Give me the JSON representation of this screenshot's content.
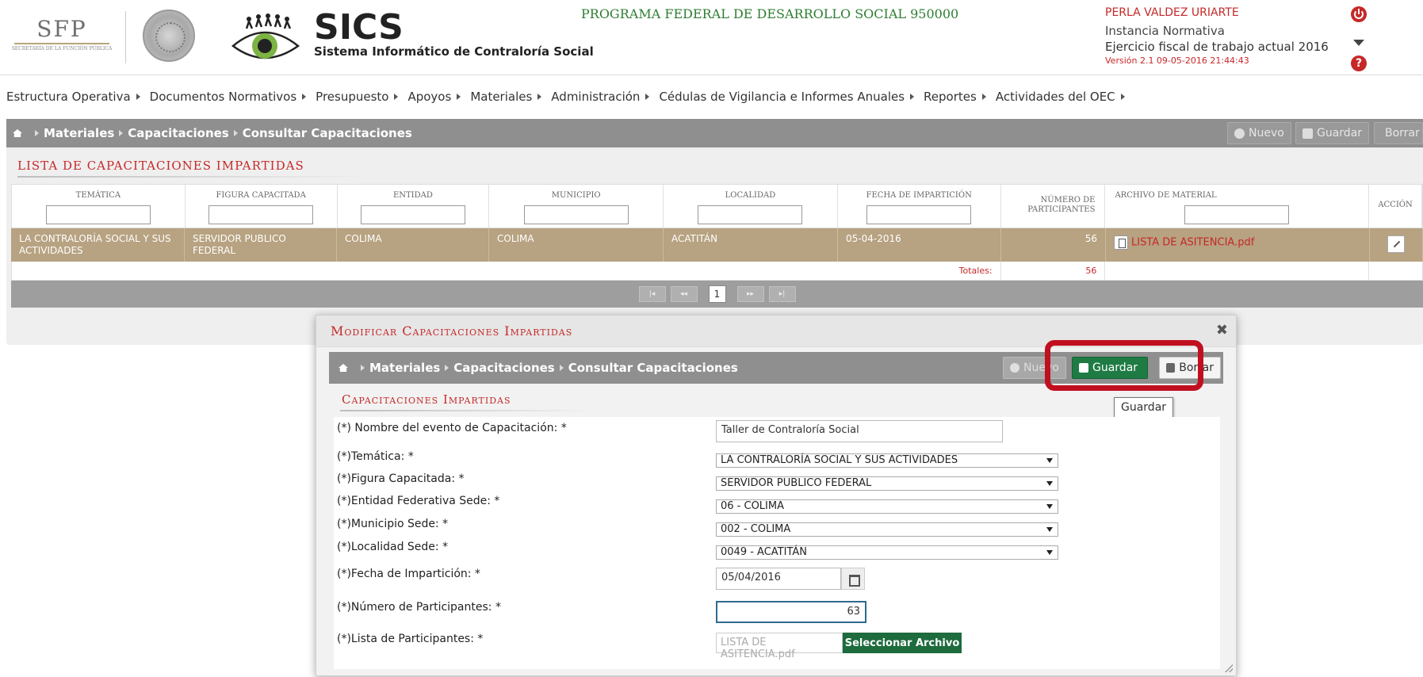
{
  "header": {
    "sfp": {
      "name": "SFP",
      "subtitle": "SECRETARÍA DE LA FUNCIÓN PÚBLICA"
    },
    "sics_title": "SICS",
    "sics_subtitle": "Sistema Informático de Contraloría Social",
    "program_title": "PROGRAMA FEDERAL DE DESARROLLO SOCIAL 950000",
    "user": {
      "name": "PERLA VALDEZ URIARTE",
      "role": "Instancia Normativa",
      "ejercicio": "Ejercicio fiscal de trabajo actual  2016",
      "version": "Versión 2.1    09-05-2016 21:44:43"
    },
    "icons": {
      "power": "power-icon",
      "menu": "chevron-down-icon",
      "help": "help-icon"
    },
    "help_glyph": "?"
  },
  "nav": {
    "items": [
      {
        "label": "Estructura Operativa"
      },
      {
        "label": "Documentos Normativos"
      },
      {
        "label": "Presupuesto"
      },
      {
        "label": "Apoyos"
      },
      {
        "label": "Materiales"
      },
      {
        "label": "Administración"
      },
      {
        "label": "Cédulas de Vigilancia e Informes Anuales"
      },
      {
        "label": "Reportes"
      },
      {
        "label": "Actividades del OEC"
      }
    ]
  },
  "main": {
    "breadcrumb": [
      "Materiales",
      "Capacitaciones",
      "Consultar Capacitaciones"
    ],
    "toolbar": {
      "nuevo": "Nuevo",
      "guardar": "Guardar",
      "borrar": "Borrar"
    },
    "list_title": "Lista de Capacitaciones Impartidas",
    "columns": {
      "tematica": "Temática",
      "figura": "Figura Capacitada",
      "entidad": "Entidad",
      "municipio": "Municipio",
      "localidad": "Localidad",
      "fecha": "Fecha de Impartición",
      "numero": "Número de Participantes",
      "archivo": "Archivo de Material",
      "accion": "Acción"
    },
    "row": {
      "tematica": "LA CONTRALORÍA SOCIAL Y SUS ACTIVIDADES",
      "figura": "SERVIDOR PUBLICO FEDERAL",
      "entidad": "COLIMA",
      "municipio": "COLIMA",
      "localidad": "ACATITÁN",
      "fecha": "05-04-2016",
      "numero": "56",
      "archivo": "LISTA DE ASITENCIA.pdf"
    },
    "totals": {
      "label": "Totales:",
      "value": "56"
    },
    "pager": {
      "first": "|◂",
      "prev": "◂◂",
      "page": "1",
      "next": "▸▸",
      "last": "▸|"
    }
  },
  "modal": {
    "title": "Modificar Capacitaciones Impartidas",
    "close": "✖",
    "breadcrumb": [
      "Materiales",
      "Capacitaciones",
      "Consultar Capacitaciones"
    ],
    "toolbar": {
      "nuevo": "Nuevo",
      "guardar": "Guardar",
      "borrar": "Borrar"
    },
    "tooltip": "Guardar",
    "section_title": "Capacitaciones Impartidas",
    "fields": {
      "nombre": {
        "label": "(*) Nombre del evento de Capacitación: *",
        "value": "Taller de Contraloría Social"
      },
      "tematica": {
        "label": "(*)Temática: *",
        "value": "LA CONTRALORÍA SOCIAL Y SUS ACTIVIDADES"
      },
      "figura": {
        "label": "(*)Figura Capacitada: *",
        "value": "SERVIDOR PUBLICO FEDERAL"
      },
      "entidad": {
        "label": "(*)Entidad Federativa Sede: *",
        "value": "06 - COLIMA"
      },
      "municipio": {
        "label": "(*)Municipio Sede: *",
        "value": "002 - COLIMA"
      },
      "localidad": {
        "label": "(*)Localidad Sede: *",
        "value": "0049 - ACATITÁN"
      },
      "fecha": {
        "label": "(*)Fecha de Impartición: *",
        "value": "05/04/2016"
      },
      "numero": {
        "label": "(*)Número de Participantes: *",
        "value": "63"
      },
      "lista": {
        "label": "(*)Lista de Participantes: *",
        "placeholder": "LISTA DE ASITENCIA.pdf",
        "button": "Seleccionar Archivo"
      }
    }
  }
}
